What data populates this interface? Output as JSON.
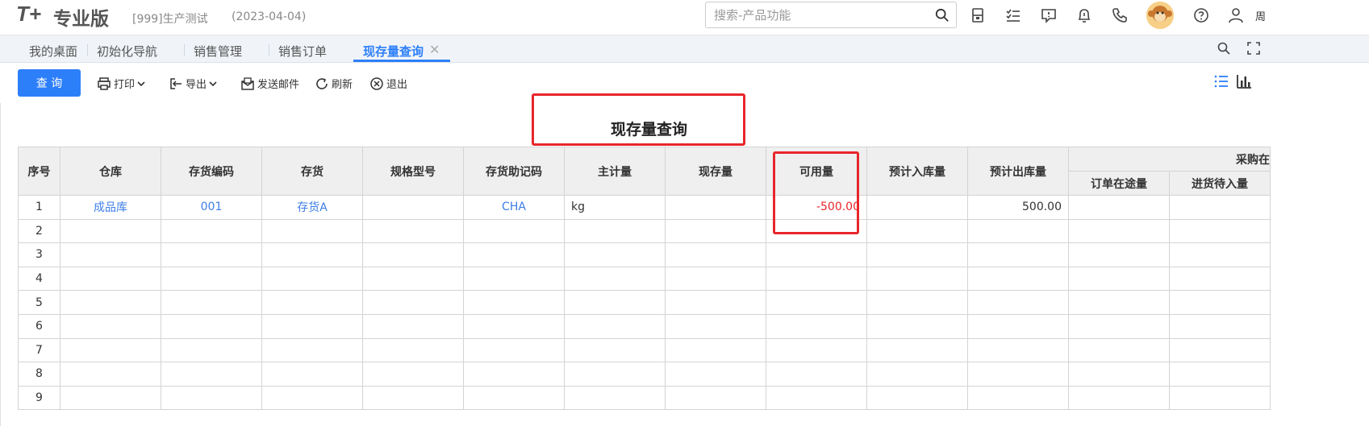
{
  "header": {
    "logo": "T+",
    "logo_sub": "专业版",
    "company": "[999]生产测试",
    "date": "(2023-04-04)",
    "search_placeholder": "搜索-产品功能",
    "user_initial": "周"
  },
  "tabs": [
    {
      "label": "我的桌面"
    },
    {
      "label": "初始化导航"
    },
    {
      "label": "销售管理"
    },
    {
      "label": "销售订单"
    },
    {
      "label": "现存量查询",
      "active": true
    }
  ],
  "toolbar": {
    "query": "查 询",
    "print": "打印",
    "export": "导出",
    "send_mail": "发送邮件",
    "refresh": "刷新",
    "exit": "退出"
  },
  "report": {
    "title": "现存量查询",
    "columns": [
      "序号",
      "仓库",
      "存货编码",
      "存货",
      "规格型号",
      "存货助记码",
      "主计量",
      "现存量",
      "可用量",
      "预计入库量",
      "预计出库量"
    ],
    "group_header": "采购在",
    "sub_columns": [
      "订单在途量",
      "进货待入量"
    ],
    "rows": [
      {
        "no": "1",
        "warehouse": "成品库",
        "code": "001",
        "item": "存货A",
        "spec": "",
        "mnemonic": "CHA",
        "unit": "kg",
        "onhand": "",
        "available": "-500.00",
        "in_qty": "",
        "out_qty": "500.00",
        "po_transit": "",
        "po_pending": ""
      },
      {
        "no": "2"
      },
      {
        "no": "3"
      },
      {
        "no": "4"
      },
      {
        "no": "5"
      },
      {
        "no": "6"
      },
      {
        "no": "7"
      },
      {
        "no": "8"
      },
      {
        "no": "9"
      }
    ]
  },
  "colors": {
    "accent": "#2d7ff9",
    "highlight": "#e8262b",
    "link": "#3d7ee6"
  }
}
